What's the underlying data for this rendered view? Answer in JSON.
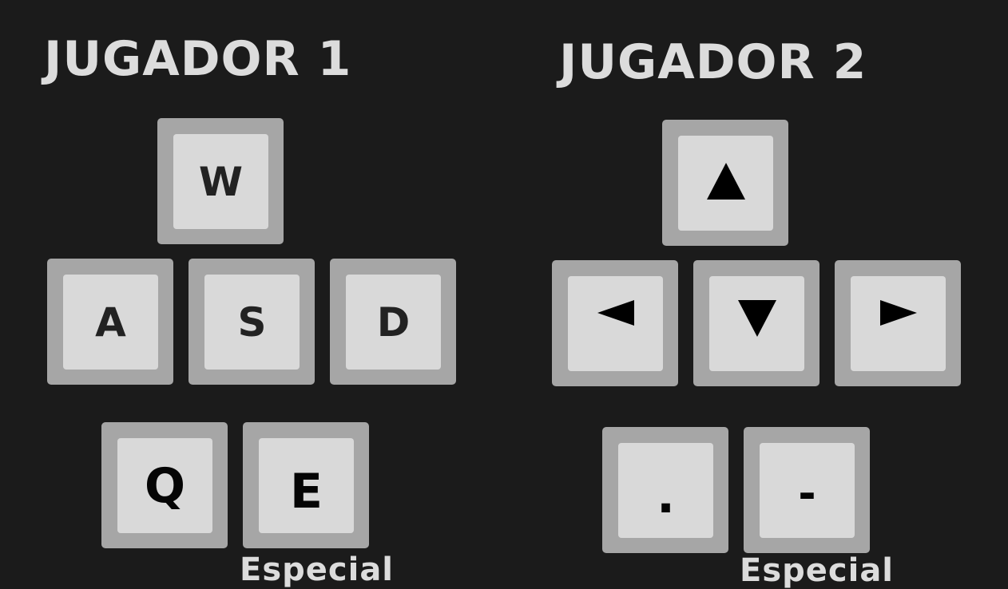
{
  "player1": {
    "title": "JUGADOR 1",
    "keys": {
      "up": "W",
      "left": "A",
      "down": "S",
      "right": "D",
      "action1": "Q",
      "action2": "E"
    },
    "special_label": "Especial"
  },
  "player2": {
    "title": "JUGADOR 2",
    "keys": {
      "up": "arrow-up-icon",
      "left": "arrow-left-icon",
      "down": "arrow-down-icon",
      "right": "arrow-right-icon",
      "action1": ".",
      "action2": "-"
    },
    "special_label": "Especial"
  },
  "colors": {
    "background": "#1b1b1b",
    "title_text": "#dcdcdc",
    "key_border": "#a6a6a6",
    "key_face": "#d9d9d9",
    "key_label": "#222222"
  }
}
